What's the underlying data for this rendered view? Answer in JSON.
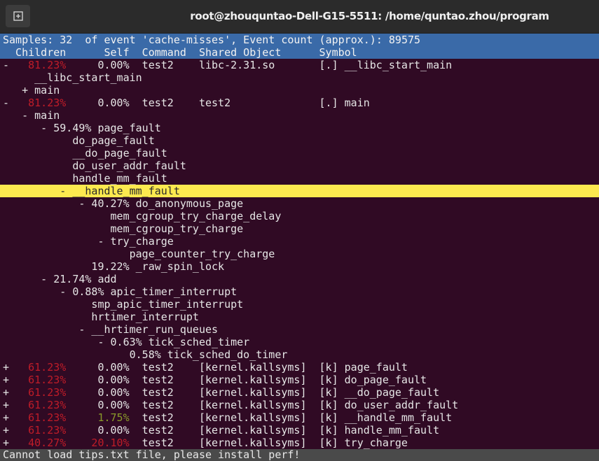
{
  "window": {
    "title": "root@zhouquntao-Dell-G15-5511: /home/quntao.zhou/program",
    "new_tab_icon": "new-tab-icon"
  },
  "colors": {
    "background": "#300a24",
    "header": "#3a6aa8",
    "highlight": "#fce94f",
    "high_percent": "#c01c28",
    "low_percent": "#8a9a2a"
  },
  "header": {
    "summary": "Samples: 32  of event 'cache-misses', Event count (approx.): 89575",
    "columns": [
      "Children",
      "Self",
      "Command",
      "Shared Object",
      "Symbol"
    ]
  },
  "rows": [
    {
      "toggle": "-",
      "children": "81.23%",
      "self": "0.00%",
      "command": "test2",
      "object": "libc-2.31.so",
      "symbol": "[.] __libc_start_main"
    },
    {
      "toggle": "-",
      "children": "81.23%",
      "self": "0.00%",
      "command": "test2",
      "object": "test2",
      "symbol": "[.] main"
    },
    {
      "toggle": "+",
      "children": "61.23%",
      "self": "0.00%",
      "command": "test2",
      "object": "[kernel.kallsyms]",
      "symbol": "[k] page_fault"
    },
    {
      "toggle": "+",
      "children": "61.23%",
      "self": "0.00%",
      "command": "test2",
      "object": "[kernel.kallsyms]",
      "symbol": "[k] do_page_fault"
    },
    {
      "toggle": "+",
      "children": "61.23%",
      "self": "0.00%",
      "command": "test2",
      "object": "[kernel.kallsyms]",
      "symbol": "[k] __do_page_fault"
    },
    {
      "toggle": "+",
      "children": "61.23%",
      "self": "0.00%",
      "command": "test2",
      "object": "[kernel.kallsyms]",
      "symbol": "[k] do_user_addr_fault"
    },
    {
      "toggle": "+",
      "children": "61.23%",
      "self": "1.75%",
      "command": "test2",
      "object": "[kernel.kallsyms]",
      "symbol": "[k] __handle_mm_fault"
    },
    {
      "toggle": "+",
      "children": "61.23%",
      "self": "0.00%",
      "command": "test2",
      "object": "[kernel.kallsyms]",
      "symbol": "[k] handle_mm_fault"
    },
    {
      "toggle": "+",
      "children": "40.27%",
      "self": "20.10%",
      "command": "test2",
      "object": "[kernel.kallsyms]",
      "symbol": "[k] try_charge"
    }
  ],
  "callgraph_1": [
    "__libc_start_main",
    "+ main"
  ],
  "callgraph_2": [
    "- main",
    "- 59.49% page_fault",
    "do_page_fault",
    "__do_page_fault",
    "do_user_addr_fault",
    "handle_mm_fault",
    "- __handle_mm_fault",
    "- 40.27% do_anonymous_page",
    "mem_cgroup_try_charge_delay",
    "mem_cgroup_try_charge",
    "- try_charge",
    "page_counter_try_charge",
    "19.22% _raw_spin_lock",
    "- 21.74% add",
    "- 0.88% apic_timer_interrupt",
    "smp_apic_timer_interrupt",
    "hrtimer_interrupt",
    "- __hrtimer_run_queues",
    "- 0.63% tick_sched_timer",
    "0.58% tick_sched_do_timer"
  ],
  "footer": "Cannot load tips.txt file, please install perf!"
}
